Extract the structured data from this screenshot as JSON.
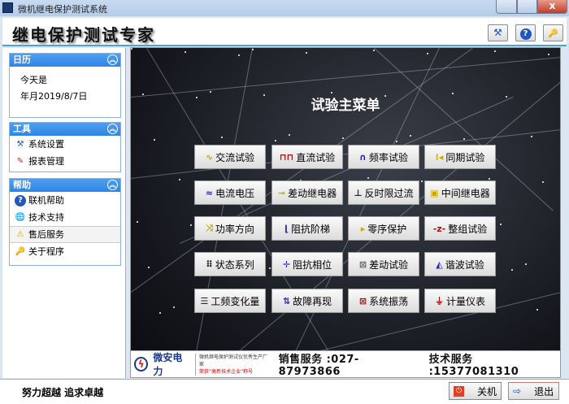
{
  "window": {
    "title": "微机继电保护测试系统",
    "close": "x"
  },
  "header": {
    "title": "继电保护测试专家",
    "buttons": [
      {
        "icon": "hammer-icon",
        "glyph": "⚒"
      },
      {
        "icon": "help-icon",
        "glyph": "?"
      },
      {
        "icon": "key-icon",
        "glyph": "🔑"
      }
    ]
  },
  "sidebar": {
    "calendar": {
      "title": "日历",
      "line1": "今天是",
      "line2": "年月2019/8/7日"
    },
    "tools": {
      "title": "工具",
      "items": [
        {
          "label": "系统设置",
          "icon": "⚒"
        },
        {
          "label": "报表管理",
          "icon": "✎"
        }
      ]
    },
    "help": {
      "title": "帮助",
      "items": [
        {
          "label": "联机帮助",
          "icon": "?"
        },
        {
          "label": "技术支持",
          "icon": "🌐"
        },
        {
          "label": "售后服务",
          "icon": "⚠"
        },
        {
          "label": "关于程序",
          "icon": "🔑"
        }
      ]
    }
  },
  "main": {
    "title": "试验主菜单",
    "buttons": [
      {
        "label": "交流试验",
        "icon": "∿",
        "color": "#c9a800"
      },
      {
        "label": "直流试验",
        "icon": "⊓⊓",
        "color": "#b01010"
      },
      {
        "label": "频率试验",
        "icon": "∩",
        "color": "#1a2ab0"
      },
      {
        "label": "同期试验",
        "icon": "⁞◂",
        "color": "#c9a800"
      },
      {
        "label": "电流电压",
        "icon": "≈",
        "color": "#2a2ab0"
      },
      {
        "label": "差动继电器",
        "icon": "⊸",
        "color": "#c9a800"
      },
      {
        "label": "反时限过流",
        "icon": "⊥",
        "color": "#222"
      },
      {
        "label": "中间继电器",
        "icon": "▣",
        "color": "#c9a800"
      },
      {
        "label": "功率方向",
        "icon": "⤨",
        "color": "#c9a800"
      },
      {
        "label": "阻抗阶梯",
        "icon": "⌊",
        "color": "#2a2ab0"
      },
      {
        "label": "零序保护",
        "icon": "▸",
        "color": "#c9a800"
      },
      {
        "label": "整组试验",
        "icon": "-z-",
        "color": "#b01010"
      },
      {
        "label": "状态系列",
        "icon": "⠿",
        "color": "#222"
      },
      {
        "label": "阻抗相位",
        "icon": "✛",
        "color": "#2a2ab0"
      },
      {
        "label": "差动试验",
        "icon": "⊠",
        "color": "#666"
      },
      {
        "label": "谐波试验",
        "icon": "◭",
        "color": "#1a2ab0"
      },
      {
        "label": "工频变化量",
        "icon": "☰",
        "color": "#222"
      },
      {
        "label": "故障再现",
        "icon": "⇅",
        "color": "#2a2ab0"
      },
      {
        "label": "系统振荡",
        "icon": "⊠",
        "color": "#b01010"
      },
      {
        "label": "计量仪表",
        "icon": "⏚",
        "color": "#b01010"
      }
    ],
    "footer": {
      "brand": "微安电力",
      "brand_line1": "微机继电保护测试仪优秀生产厂家",
      "brand_line2": "荣获“高新技术企业”称号",
      "sales": "销售服务 :027-87973866",
      "tech": "技术服务 :15377081310"
    }
  },
  "statusbar": {
    "slogan": "努力超越  追求卓越",
    "shutdown": "关机",
    "exit": "退出"
  }
}
